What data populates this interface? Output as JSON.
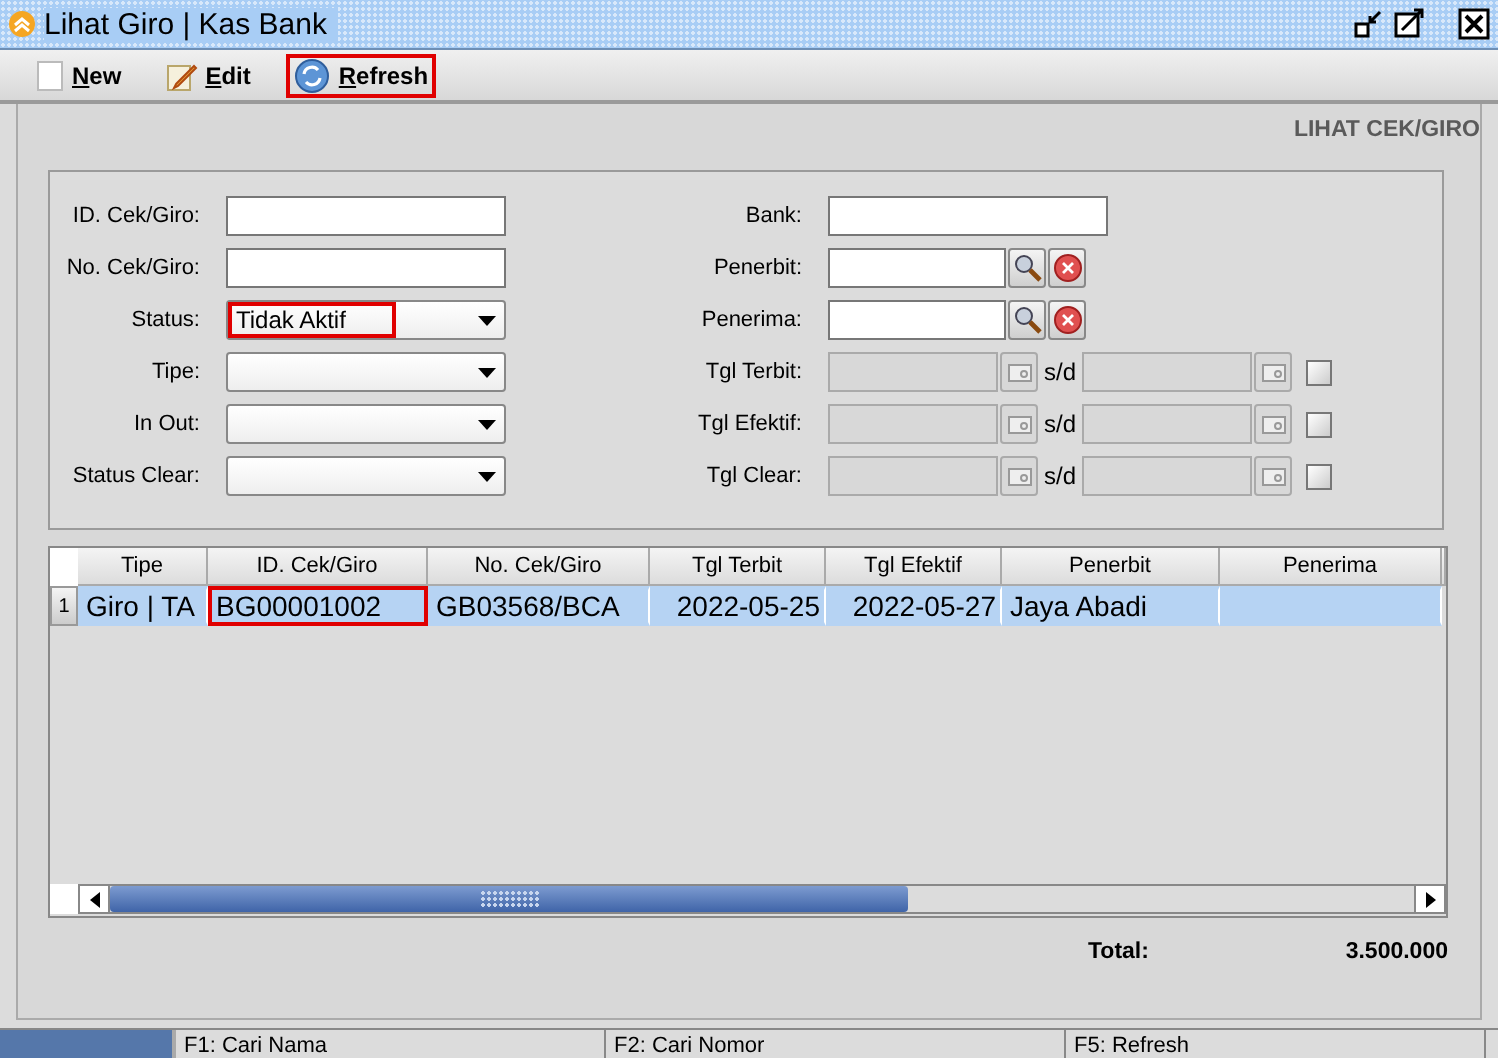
{
  "window": {
    "title": "Lihat Giro | Kas Bank"
  },
  "toolbar": [
    {
      "label": "New",
      "kind": "new",
      "highlighted": false
    },
    {
      "label": "Edit",
      "kind": "edit",
      "highlighted": false
    },
    {
      "label": "Refresh",
      "kind": "refresh",
      "highlighted": true
    }
  ],
  "heading": "LIHAT CEK/GIRO",
  "form_left": [
    {
      "label": "ID. Cek/Giro:",
      "kind": "text"
    },
    {
      "label": "No. Cek/Giro:",
      "kind": "text"
    },
    {
      "label": "Status:",
      "kind": "combo",
      "value": "Tidak Aktif",
      "highlighted": true
    },
    {
      "label": "Tipe:",
      "kind": "combo",
      "highlighted": false
    },
    {
      "label": "In Out:",
      "kind": "combo",
      "highlighted": false
    },
    {
      "label": "Status Clear:",
      "kind": "combo",
      "highlighted": false
    }
  ],
  "form_right": [
    {
      "label": "Bank:",
      "kind": "text"
    },
    {
      "label": "Penerbit:",
      "kind": "lookup"
    },
    {
      "label": "Penerima:",
      "kind": "lookup"
    },
    {
      "label": "Tgl Terbit:",
      "kind": "range",
      "separator": "s/d",
      "checked": false
    },
    {
      "label": "Tgl Efektif:",
      "kind": "range",
      "separator": "s/d",
      "checked": false
    },
    {
      "label": "Tgl Clear:",
      "kind": "range",
      "separator": "s/d",
      "checked": false
    }
  ],
  "table": {
    "columns": [
      "Tipe",
      "ID. Cek/Giro",
      "No. Cek/Giro",
      "Tgl Terbit",
      "Tgl Efektif",
      "Penerbit",
      "Penerima"
    ],
    "rows": [
      {
        "number": "1",
        "selected": true,
        "cells": [
          {
            "text": "Giro | TA",
            "kind": "text",
            "highlighted": false
          },
          {
            "text": "BG00001002",
            "kind": "text",
            "highlighted": true
          },
          {
            "text": "GB03568/BCA",
            "kind": "text",
            "highlighted": false
          },
          {
            "text": "2022-05-25",
            "kind": "date",
            "highlighted": false
          },
          {
            "text": "2022-05-27",
            "kind": "date",
            "highlighted": false
          },
          {
            "text": "Jaya Abadi",
            "kind": "text",
            "highlighted": false
          },
          {
            "text": "",
            "kind": "text",
            "highlighted": false
          }
        ]
      }
    ]
  },
  "total": {
    "label": "Total:",
    "value": "3.500.000"
  },
  "status_bar": [
    "F1: Cari Nama",
    "F2: Cari Nomor",
    "F5: Refresh"
  ]
}
